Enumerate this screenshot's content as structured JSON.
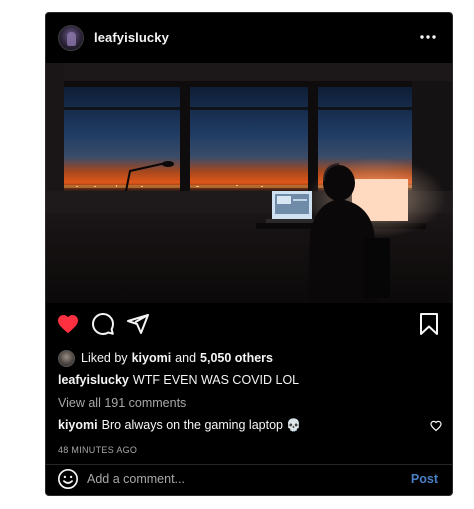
{
  "post": {
    "username": "leafyislucky",
    "photo_alt": "",
    "liked": true,
    "likes": {
      "prefix": "Liked by",
      "liker": "kiyomi",
      "joiner": "and",
      "count": "5,050 others"
    },
    "caption": {
      "username": "leafyislucky",
      "text": "WTF EVEN WAS COVID LOL"
    },
    "view_comments": "View all 191 comments",
    "top_comment": {
      "username": "kiyomi",
      "text": "Bro always on the gaming laptop",
      "emoji": "💀"
    },
    "timestamp": "48 MINUTES AGO"
  },
  "comment_bar": {
    "placeholder": "Add a comment...",
    "value": "",
    "post_label": "Post"
  },
  "icons": {
    "more": "more-options-icon",
    "like": "heart-icon",
    "comment": "comment-bubble-icon",
    "share": "paper-plane-icon",
    "save": "bookmark-icon",
    "emoji": "smiley-icon",
    "comment_like": "small-heart-icon"
  },
  "colors": {
    "background": "#000000",
    "text": "#f5f5f5",
    "secondary_text": "#a8a8a8",
    "like_red": "#ff3040",
    "post_blue": "#4a7fc4"
  }
}
